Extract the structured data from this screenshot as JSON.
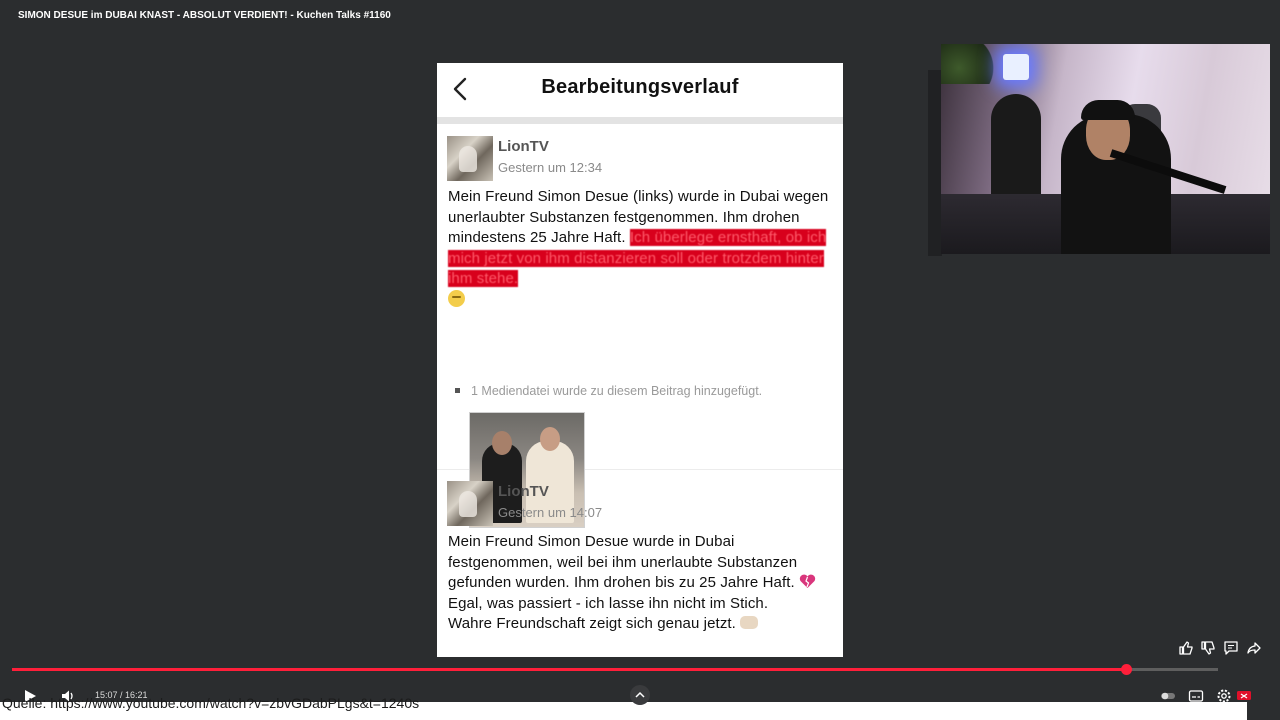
{
  "video": {
    "title": "SIMON DESUE im DUBAI KNAST - ABSOLUT VERDIENT! - Kuchen Talks #1160",
    "time_readout": "15:07 / 16:21",
    "progress_fraction": 0.924,
    "source_text": "Quelle: https://www.youtube.com/watch?v=zbvGDabPLgs&t=1240s"
  },
  "phone": {
    "header_title": "Bearbeitungsverlauf",
    "entries": [
      {
        "user": "LionTV",
        "timestamp": "Gestern um 12:34",
        "text": "Mein Freund Simon Desue (links) wurde in Dubai wegen unerlaubter Substanzen festgenommen. Ihm drohen mindestens 25 Jahre Haft.",
        "deleted_text": "Ich überlege ernsthaft, ob ich mich jetzt von ihm distanzieren soll oder trotzdem hinter ihm stehe.",
        "media_note": "1 Mediendatei wurde zu diesem Beitrag hinzugefügt."
      },
      {
        "user": "LionTV",
        "timestamp": "Gestern um 14:07",
        "text_line1": "Mein Freund Simon Desue wurde in Dubai festgenommen, weil bei ihm unerlaubte Substanzen gefunden wurden. Ihm drohen bis zu 25 Jahre Haft.",
        "text_line2": "Egal, was passiert - ich lasse ihn nicht im Stich.",
        "text_line3": "Wahre Freundschaft zeigt sich genau jetzt."
      }
    ]
  },
  "icons": {
    "back": "chevron-left-icon",
    "play": "play-icon",
    "volume": "volume-icon",
    "like": "thumbs-up-icon",
    "dislike": "thumbs-down-icon",
    "comment": "comment-icon",
    "share": "share-icon",
    "settings": "gear-icon"
  },
  "colors": {
    "accent": "#ff1f3a",
    "deleted_highlight": "#d8001c",
    "background": "#2b2d2f"
  }
}
